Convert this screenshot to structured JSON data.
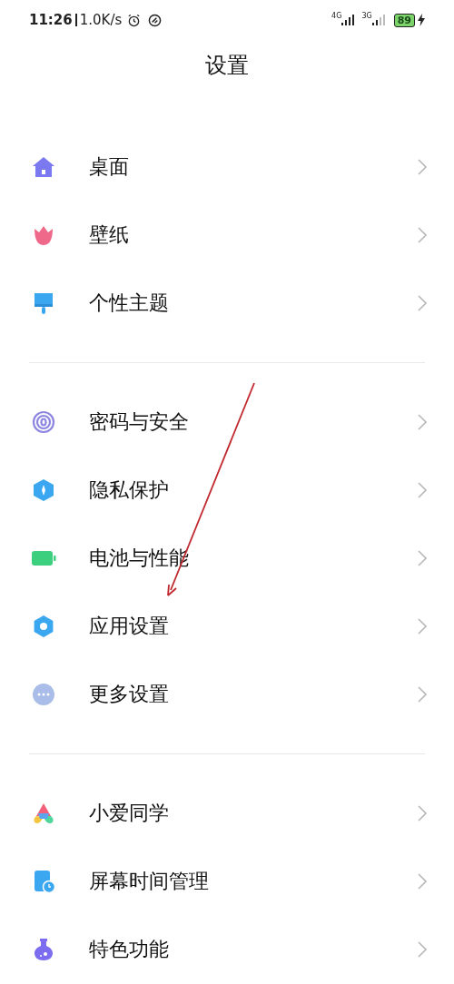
{
  "status_bar": {
    "time": "11:26",
    "speed": "1.0K/s",
    "signal_1": "4G",
    "signal_2": "3G",
    "battery": "89"
  },
  "title": "设置",
  "groups": [
    {
      "items": [
        {
          "kind": "home",
          "label": "桌面"
        },
        {
          "kind": "tulip",
          "label": "壁纸"
        },
        {
          "kind": "brush",
          "label": "个性主题"
        }
      ]
    },
    {
      "items": [
        {
          "kind": "fingerprint",
          "label": "密码与安全"
        },
        {
          "kind": "shield",
          "label": "隐私保护"
        },
        {
          "kind": "battery",
          "label": "电池与性能"
        },
        {
          "kind": "gear",
          "label": "应用设置"
        },
        {
          "kind": "more",
          "label": "更多设置"
        }
      ]
    },
    {
      "items": [
        {
          "kind": "assistant",
          "label": "小爱同学"
        },
        {
          "kind": "screentime",
          "label": "屏幕时间管理"
        },
        {
          "kind": "flask",
          "label": "特色功能"
        }
      ]
    }
  ]
}
